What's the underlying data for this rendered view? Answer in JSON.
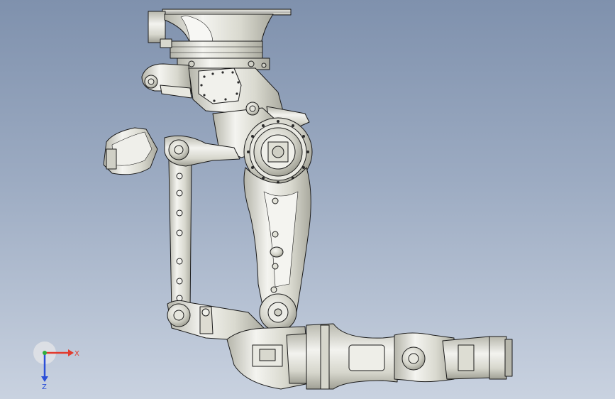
{
  "viewport": {
    "name": "CAD 3D viewport",
    "subject": "robot-arm-assembly"
  },
  "axis_triad": {
    "x_label": "X",
    "z_label": "Z",
    "colors": {
      "x": "#e23b2e",
      "y": "#2fae3c",
      "z": "#2b4fd8"
    }
  },
  "colors": {
    "background_top": "#7f91ad",
    "background_bottom": "#c9d2e0",
    "metal_light": "#f2f2ee",
    "metal_mid": "#dcdcd2",
    "metal_dark": "#a8a89c",
    "outline": "#1a1a1a"
  }
}
